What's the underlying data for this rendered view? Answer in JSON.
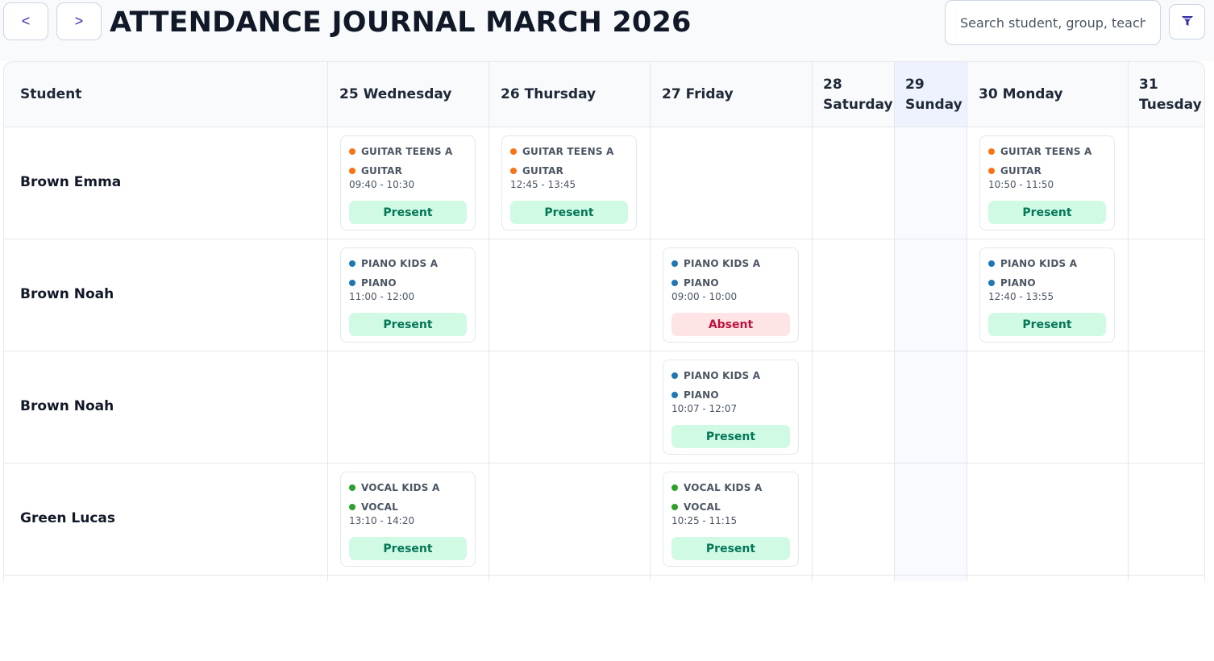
{
  "toolbar": {
    "prev_label": "<",
    "next_label": ">",
    "title": "ATTENDANCE JOURNAL MARCH 2026",
    "search_placeholder": "Search student, group, teacher...",
    "filter_icon": "filter-icon"
  },
  "colors": {
    "accent": "#3730a3",
    "guitar": "#f97316",
    "piano": "#1f77b4",
    "vocal": "#2ca02c",
    "present_bg": "#d1fae5",
    "present_text": "#047857",
    "absent_bg": "#ffe4e6",
    "absent_text": "#be123c",
    "sunday_bg": "#eef2ff"
  },
  "table": {
    "student_header": "Student",
    "days": [
      {
        "day": "25",
        "weekday": "Wednesday"
      },
      {
        "day": "26",
        "weekday": "Thursday"
      },
      {
        "day": "27",
        "weekday": "Friday"
      },
      {
        "day": "28",
        "weekday": "Saturday"
      },
      {
        "day": "29",
        "weekday": "Sunday"
      },
      {
        "day": "30",
        "weekday": "Monday"
      },
      {
        "day": "31",
        "weekday": "Tuesday"
      }
    ],
    "rows": [
      {
        "student": "Brown Emma",
        "lessons": [
          {
            "day_index": 0,
            "group": "GUITAR TEENS A",
            "subject": "GUITAR",
            "time": "09:40 - 10:30",
            "status": "Present",
            "color": "#f97316"
          },
          {
            "day_index": 1,
            "group": "GUITAR TEENS A",
            "subject": "GUITAR",
            "time": "12:45 - 13:45",
            "status": "Present",
            "color": "#f97316"
          },
          {
            "day_index": 5,
            "group": "GUITAR TEENS A",
            "subject": "GUITAR",
            "time": "10:50 - 11:50",
            "status": "Present",
            "color": "#f97316"
          }
        ]
      },
      {
        "student": "Brown Noah",
        "lessons": [
          {
            "day_index": 0,
            "group": "PIANO KIDS A",
            "subject": "PIANO",
            "time": "11:00 - 12:00",
            "status": "Present",
            "color": "#1f77b4"
          },
          {
            "day_index": 2,
            "group": "PIANO KIDS A",
            "subject": "PIANO",
            "time": "09:00 - 10:00",
            "status": "Absent",
            "color": "#1f77b4"
          },
          {
            "day_index": 5,
            "group": "PIANO KIDS A",
            "subject": "PIANO",
            "time": "12:40 - 13:55",
            "status": "Present",
            "color": "#1f77b4"
          }
        ]
      },
      {
        "student": "Brown Noah",
        "lessons": [
          {
            "day_index": 2,
            "group": "PIANO KIDS A",
            "subject": "PIANO",
            "time": "10:07 - 12:07",
            "status": "Present",
            "color": "#1f77b4"
          }
        ]
      },
      {
        "student": "Green Lucas",
        "lessons": [
          {
            "day_index": 0,
            "group": "VOCAL KIDS A",
            "subject": "VOCAL",
            "time": "13:10 - 14:20",
            "status": "Present",
            "color": "#2ca02c"
          },
          {
            "day_index": 2,
            "group": "VOCAL KIDS A",
            "subject": "VOCAL",
            "time": "10:25 - 11:15",
            "status": "Present",
            "color": "#2ca02c"
          }
        ]
      }
    ]
  }
}
